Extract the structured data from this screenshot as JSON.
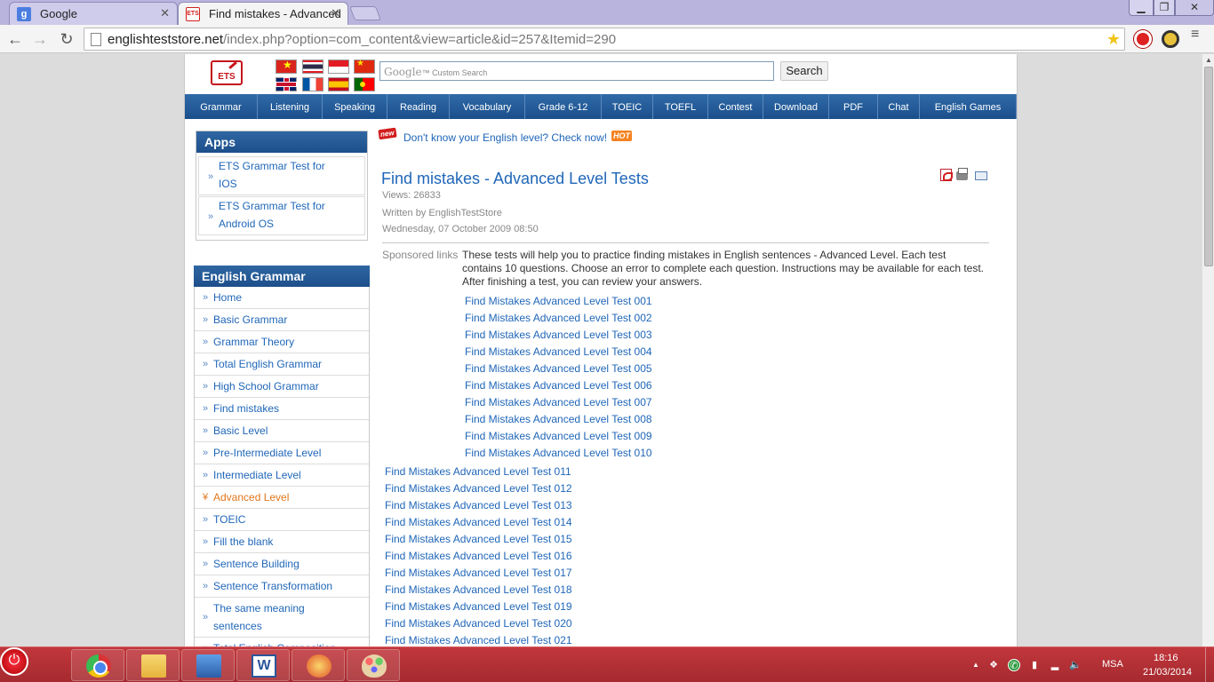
{
  "browser": {
    "tabs": [
      {
        "label": "Google",
        "favicon": "g"
      },
      {
        "label": "Find mistakes - Advanced",
        "favicon": "ETS"
      }
    ],
    "url_host": "englishteststore.net",
    "url_path": "/index.php?option=com_content&view=article&id=257&Itemid=290"
  },
  "header": {
    "logo_text": "ETS",
    "search_placeholder_brand": "Google",
    "search_placeholder": "Custom Search",
    "search_button": "Search"
  },
  "nav": [
    {
      "label": "Grammar",
      "w": 82
    },
    {
      "label": "Listening",
      "w": 73
    },
    {
      "label": "Speaking",
      "w": 73
    },
    {
      "label": "Reading",
      "w": 70
    },
    {
      "label": "Vocabulary",
      "w": 85
    },
    {
      "label": "Grade 6-12",
      "w": 86
    },
    {
      "label": "TOEIC",
      "w": 58
    },
    {
      "label": "TOEFL",
      "w": 62
    },
    {
      "label": "Contest",
      "w": 62
    },
    {
      "label": "Download",
      "w": 74
    },
    {
      "label": "PDF",
      "w": 55
    },
    {
      "label": "Chat",
      "w": 47
    },
    {
      "label": "English Games",
      "w": 109
    }
  ],
  "apps": {
    "title": "Apps",
    "items": [
      {
        "line1": "ETS Grammar Test for",
        "line2": "IOS"
      },
      {
        "line1": "ETS Grammar Test for",
        "line2": "Android OS"
      }
    ]
  },
  "grammar": {
    "title": "English Grammar",
    "items": [
      "Home",
      "Basic Grammar",
      "Grammar Theory",
      "Total English Grammar",
      "High School Grammar",
      "Find mistakes",
      "Basic Level",
      "Pre-Intermediate Level",
      "Intermediate Level",
      "Advanced Level",
      "TOEIC",
      "Fill the blank",
      "Sentence Building",
      "Sentence Transformation"
    ],
    "tall_item": {
      "line1": "The same meaning",
      "line2": "sentences"
    },
    "cut_item": "Total English Composition"
  },
  "promo": {
    "new_badge": "new",
    "link": "Don't know your English level? Check now!",
    "hot_badge": "HOT"
  },
  "article": {
    "title": "Find mistakes - Advanced Level Tests",
    "views": "Views: 26833",
    "author": "Written by EnglishTestStore",
    "date": "Wednesday, 07 October 2009 08:50",
    "sponsored": "Sponsored links",
    "intro": "These tests will help you to practice finding mistakes in English sentences - Advanced Level. Each test contains 10 questions. Choose an error to complete each question. Instructions may be available for each test. After finishing a test, you can review your answers.",
    "tests": [
      "Find Mistakes Advanced Level Test 001",
      "Find Mistakes Advanced Level Test 002",
      "Find Mistakes Advanced Level Test 003",
      "Find Mistakes Advanced Level Test 004",
      "Find Mistakes Advanced Level Test 005",
      "Find Mistakes Advanced Level Test 006",
      "Find Mistakes Advanced Level Test 007",
      "Find Mistakes Advanced Level Test 008",
      "Find Mistakes Advanced Level Test 009",
      "Find Mistakes Advanced Level Test 010",
      "Find Mistakes Advanced Level Test 011",
      "Find Mistakes Advanced Level Test 012",
      "Find Mistakes Advanced Level Test 013",
      "Find Mistakes Advanced Level Test 014",
      "Find Mistakes Advanced Level Test 015",
      "Find Mistakes Advanced Level Test 016",
      "Find Mistakes Advanced Level Test 017",
      "Find Mistakes Advanced Level Test 018",
      "Find Mistakes Advanced Level Test 019",
      "Find Mistakes Advanced Level Test 020",
      "Find Mistakes Advanced Level Test 021"
    ]
  },
  "taskbar": {
    "word_letter": "W",
    "language": "MSA",
    "time": "18:16",
    "date": "21/03/2014"
  },
  "colors": {
    "link": "#1f66b8",
    "active": "#e0761b",
    "nav_bg": "#1b4f8b",
    "taskbar": "#b3303a"
  }
}
